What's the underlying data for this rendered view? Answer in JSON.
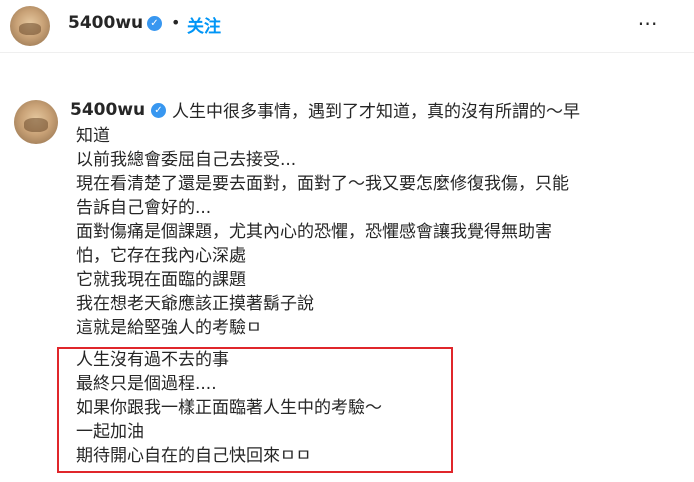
{
  "header": {
    "username": "5400wu",
    "separator": "•",
    "follow_label": "关注",
    "more_label": "⋯"
  },
  "comment": {
    "username": "5400wu",
    "caption_first": "人生中很多事情，遇到了才知道，真的沒有所謂的～早",
    "lines": [
      "知道",
      "以前我總會委屈自己去接受...",
      "現在看清楚了還是要去面對，面對了～我又要怎麼修復我傷，只能",
      "告訴自己會好的...",
      "面對傷痛是個課題，尤其內心的恐懼，恐懼感會讓我覺得無助害",
      "怕，它存在我內心深處",
      "它就我現在面臨的課題",
      "我在想老天爺應該正摸著鬍子說",
      "這就是給堅強人的考驗ㅁ",
      "人生沒有過不去的事",
      "最終只是個過程....",
      "如果你跟我一樣正面臨著人生中的考驗～",
      "一起加油",
      "期待開心自在的自己快回來ㅁㅁ"
    ]
  },
  "colors": {
    "link_blue": "#0095f6",
    "verified_blue": "#3897f0",
    "highlight_red": "#e0262b"
  },
  "icons": {
    "verified": "verified-badge-icon",
    "more": "more-options-icon"
  }
}
